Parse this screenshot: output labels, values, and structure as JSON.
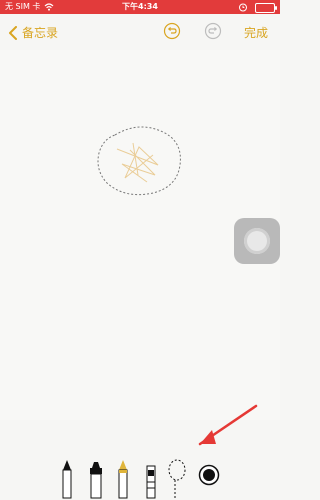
{
  "status": {
    "carrier": "无 SIM 卡",
    "time": "下午4:34"
  },
  "nav": {
    "back_label": "备忘录",
    "done_label": "完成"
  },
  "toolbar": {
    "tools": [
      "pen-icon",
      "marker-icon",
      "pencil-icon",
      "eraser-icon",
      "lasso-icon",
      "color-picker-icon"
    ]
  },
  "colors": {
    "accent": "#d9a521",
    "status_bar": "#e23b3b",
    "arrow": "#e53935"
  }
}
